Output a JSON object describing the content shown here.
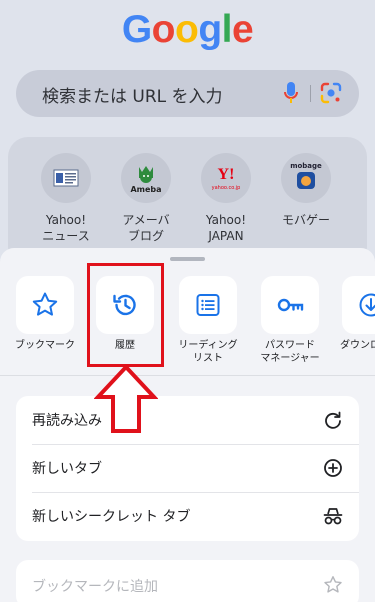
{
  "logo": {
    "text": "Google",
    "colors": [
      "#4285F4",
      "#EA4335",
      "#FBBC05",
      "#4285F4",
      "#34A853",
      "#EA4335"
    ]
  },
  "search": {
    "placeholder": "検索または URL を入力",
    "mic_icon": "mic-icon",
    "lens_icon": "google-lens-icon"
  },
  "shortcuts": [
    {
      "label": "Yahoo!\nニュース",
      "icon": "yahoo-news-icon"
    },
    {
      "label": "アメーバ\nブログ",
      "icon": "ameba-icon",
      "icon_text": "Ameba"
    },
    {
      "label": "Yahoo!\nJAPAN",
      "icon": "yahoo-japan-icon",
      "icon_text": "Y!",
      "icon_subtext": "yahoo.co.jp"
    },
    {
      "label": "モバゲー",
      "icon": "mobage-icon",
      "icon_text": "mobage"
    }
  ],
  "sheet_actions": [
    {
      "label": "ブックマーク",
      "icon": "star-icon"
    },
    {
      "label": "履歴",
      "icon": "history-icon"
    },
    {
      "label": "リーディング\nリスト",
      "icon": "reading-list-icon"
    },
    {
      "label": "パスワード\nマネージャー",
      "icon": "password-key-icon"
    },
    {
      "label": "ダウンロ",
      "icon": "download-icon"
    }
  ],
  "menu": [
    {
      "label": "再読み込み",
      "icon": "reload-icon"
    },
    {
      "label": "新しいタブ",
      "icon": "new-tab-icon"
    },
    {
      "label": "新しいシークレット タブ",
      "icon": "incognito-icon"
    }
  ],
  "menu_disabled": {
    "label": "ブックマークに追加",
    "icon": "star-outline-icon"
  },
  "annotation_color": "#e0111b",
  "accent_color": "#1a73e8"
}
